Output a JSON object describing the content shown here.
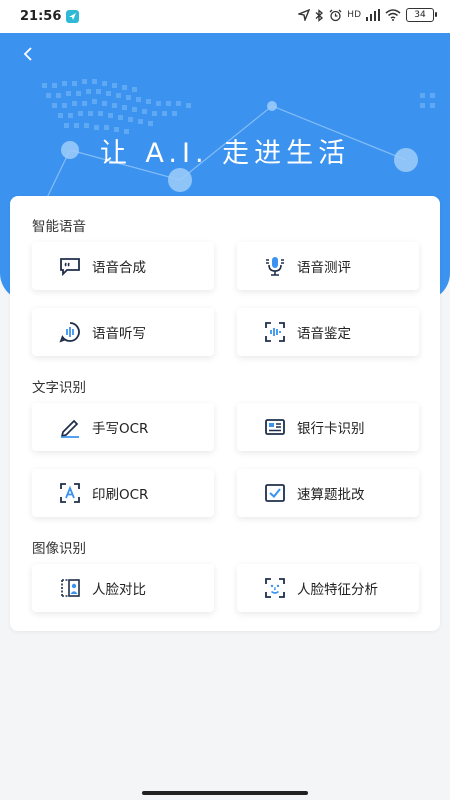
{
  "status": {
    "time": "21:56",
    "network": "HD",
    "battery": "34"
  },
  "header": {
    "slogan": "让 A.I. 走进生活"
  },
  "sections": [
    {
      "title": "智能语音",
      "items": [
        {
          "label": "语音合成",
          "icon": "speech-bubble-icon"
        },
        {
          "label": "语音测评",
          "icon": "microphone-icon"
        },
        {
          "label": "语音听写",
          "icon": "voice-wave-icon"
        },
        {
          "label": "语音鉴定",
          "icon": "voiceprint-icon"
        }
      ]
    },
    {
      "title": "文字识别",
      "items": [
        {
          "label": "手写OCR",
          "icon": "pen-icon"
        },
        {
          "label": "银行卡识别",
          "icon": "bank-card-icon"
        },
        {
          "label": "印刷OCR",
          "icon": "scan-text-icon"
        },
        {
          "label": "速算题批改",
          "icon": "checkbox-icon"
        }
      ]
    },
    {
      "title": "图像识别",
      "items": [
        {
          "label": "人脸对比",
          "icon": "face-compare-icon"
        },
        {
          "label": "人脸特征分析",
          "icon": "face-scan-icon"
        }
      ]
    }
  ],
  "colors": {
    "primary": "#3b93ef",
    "icon_dark": "#1f2f4a",
    "background": "#f4f5f7"
  }
}
